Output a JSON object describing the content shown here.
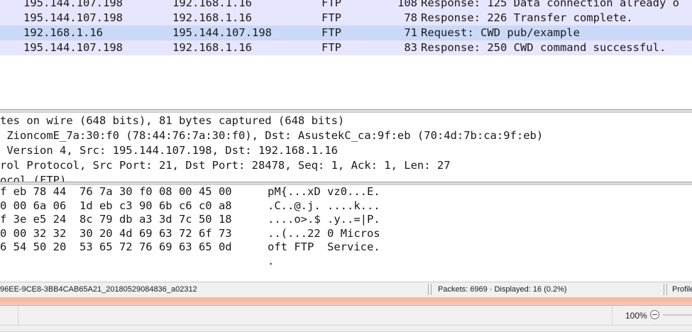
{
  "packet_list": {
    "rows": [
      {
        "src": "195.144.107.198",
        "dst": "192.168.1.16",
        "proto": "FTP",
        "len": "108",
        "info": "Response: 125 Data connection already o"
      },
      {
        "src": "195.144.107.198",
        "dst": "192.168.1.16",
        "proto": "FTP",
        "len": "78",
        "info": "Response: 226 Transfer complete."
      },
      {
        "src": "192.168.1.16",
        "dst": "195.144.107.198",
        "proto": "FTP",
        "len": "71",
        "info": "Request: CWD pub/example"
      },
      {
        "src": "195.144.107.198",
        "dst": "192.168.1.16",
        "proto": "FTP",
        "len": "83",
        "info": "Response: 250 CWD command successful."
      }
    ],
    "row_color": "#e7e6ff",
    "selected_row_color": "#c9d9f7"
  },
  "details": {
    "lines": [
      "tes on wire (648 bits), 81 bytes captured (648 bits)",
      " ZioncomE_7a:30:f0 (78:44:76:7a:30:f0), Dst: AsustekC_ca:9f:eb (70:4d:7b:ca:9f:eb)",
      " Version 4, Src: 195.144.107.198, Dst: 192.168.1.16",
      "rol Protocol, Src Port: 21, Dst Port: 28478, Seq: 1, Ack: 1, Len: 27",
      "ocol (FTP)"
    ]
  },
  "bytes": {
    "rows": [
      {
        "hex": "f eb 78 44  76 7a 30 f0 08 00 45 00",
        "ascii": "pM{...xD vz0...E."
      },
      {
        "hex": "0 00 6a 06  1d eb c3 90 6b c6 c0 a8",
        "ascii": ".C..@.j. ....k..."
      },
      {
        "hex": "f 3e e5 24  8c 79 db a3 3d 7c 50 18",
        "ascii": "....o>.$ .y..=|P."
      },
      {
        "hex": "0 00 32 32  30 20 4d 69 63 72 6f 73",
        "ascii": "..(...22 0 Micros"
      },
      {
        "hex": "6 54 50 20  53 65 72 76 69 63 65 0d",
        "ascii": "oft FTP  Service."
      },
      {
        "hex": "",
        "ascii": "."
      }
    ]
  },
  "statusbar": {
    "file": "96EE-9CE8-3BB4CAB65A21_20180529084836_a02312",
    "packets": "Packets: 6969 · Displayed: 16 (0.2%)",
    "profile": "Profile"
  },
  "bottom_bar": {
    "zoom": "100%"
  }
}
